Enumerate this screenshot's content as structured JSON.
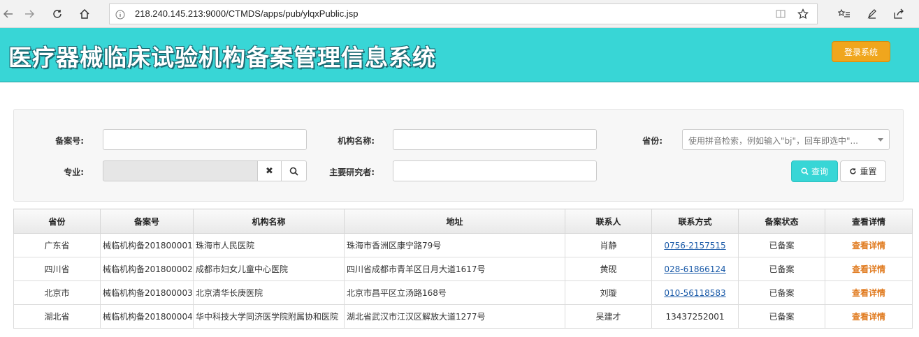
{
  "browser": {
    "url": "218.240.145.213:9000/CTMDS/apps/pub/ylqxPublic.jsp"
  },
  "header": {
    "title": "医疗器械临床试验机构备案管理信息系统",
    "login_label": "登录系统"
  },
  "search": {
    "record_no_label": "备案号:",
    "org_name_label": "机构名称:",
    "province_label": "省份:",
    "province_placeholder": "使用拼音检索，例如输入\"bj\"，回车即选中\"...",
    "specialty_label": "专业:",
    "investigator_label": "主要研究者:",
    "query_label": "查询",
    "reset_label": "重置"
  },
  "table": {
    "columns": [
      "省份",
      "备案号",
      "机构名称",
      "地址",
      "联系人",
      "联系方式",
      "备案状态",
      "查看详情"
    ],
    "rows": [
      [
        "广东省",
        "械临机构备201800001",
        "珠海市人民医院",
        "珠海市香洲区康宁路79号",
        "肖静",
        "0756-2157515",
        "已备案",
        "查看详情"
      ],
      [
        "四川省",
        "械临机构备201800002",
        "成都市妇女儿童中心医院",
        "四川省成都市青羊区日月大道1617号",
        "黄砚",
        "028-61866124",
        "已备案",
        "查看详情"
      ],
      [
        "北京市",
        "械临机构备201800003",
        "北京清华长庚医院",
        "北京市昌平区立汤路168号",
        "刘璇",
        "010-56118583",
        "已备案",
        "查看详情"
      ],
      [
        "湖北省",
        "械临机构备201800004",
        "华中科技大学同济医学院附属协和医院",
        "湖北省武汉市江汉区解放大道1277号",
        "吴建才",
        "13437252001",
        "已备案",
        "查看详情"
      ]
    ]
  },
  "colors": {
    "banner": "#38d6d6",
    "login": "#f0a61d",
    "link": "#1a5aa8",
    "detail": "#e07a1e"
  }
}
